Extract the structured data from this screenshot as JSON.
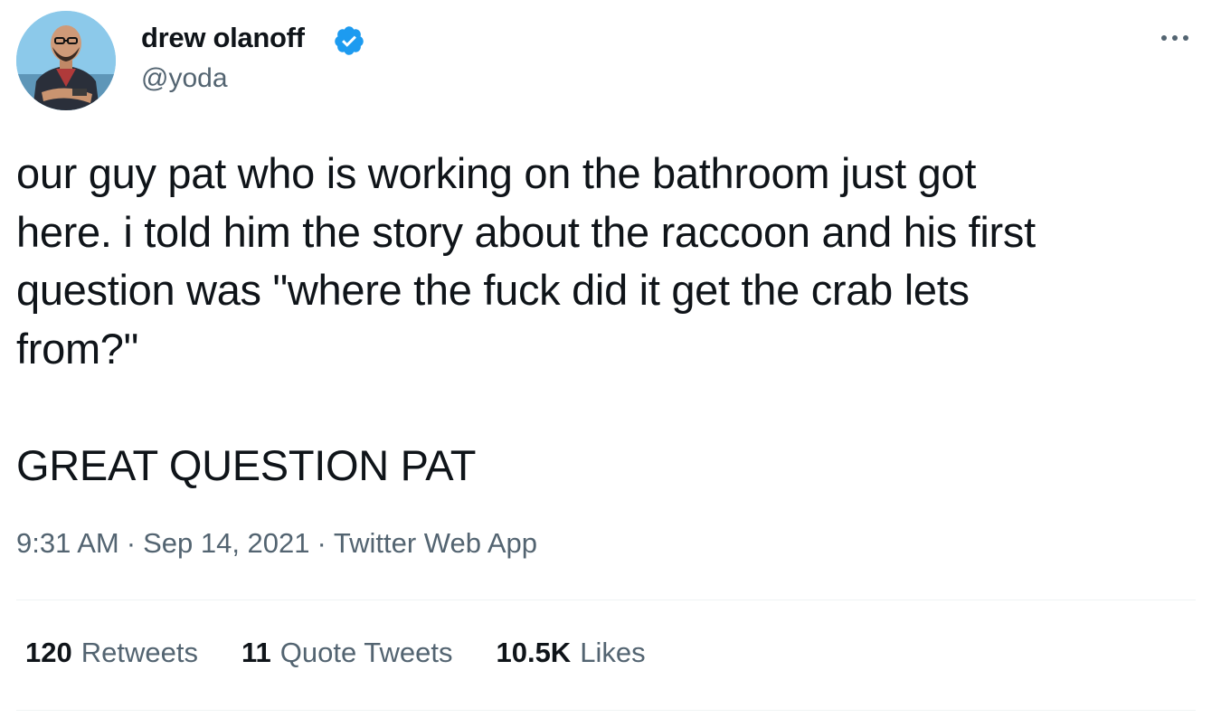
{
  "author": {
    "name": "drew olanoff",
    "handle": "@yoda",
    "verified": true,
    "avatar_icon": "profile-photo"
  },
  "more_icon": "ellipsis-icon",
  "tweet": {
    "lines": [
      "our guy pat who is working on the bathroom just got",
      "here. i told him the story about the raccoon and his first",
      "question was \"where the fuck did it get the crab lets",
      "from?\""
    ],
    "closing": "GREAT QUESTION PAT"
  },
  "meta": {
    "time": "9:31 AM",
    "separator": "·",
    "date": "Sep 14, 2021",
    "source": "Twitter Web App"
  },
  "stats": {
    "retweets": {
      "count": "120",
      "label": "Retweets"
    },
    "quotes": {
      "count": "11",
      "label": "Quote Tweets"
    },
    "likes": {
      "count": "10.5K",
      "label": "Likes"
    }
  },
  "colors": {
    "text_primary": "#0f1419",
    "text_secondary": "#536471",
    "verified_blue": "#1d9bf0",
    "divider": "#eff3f4"
  }
}
